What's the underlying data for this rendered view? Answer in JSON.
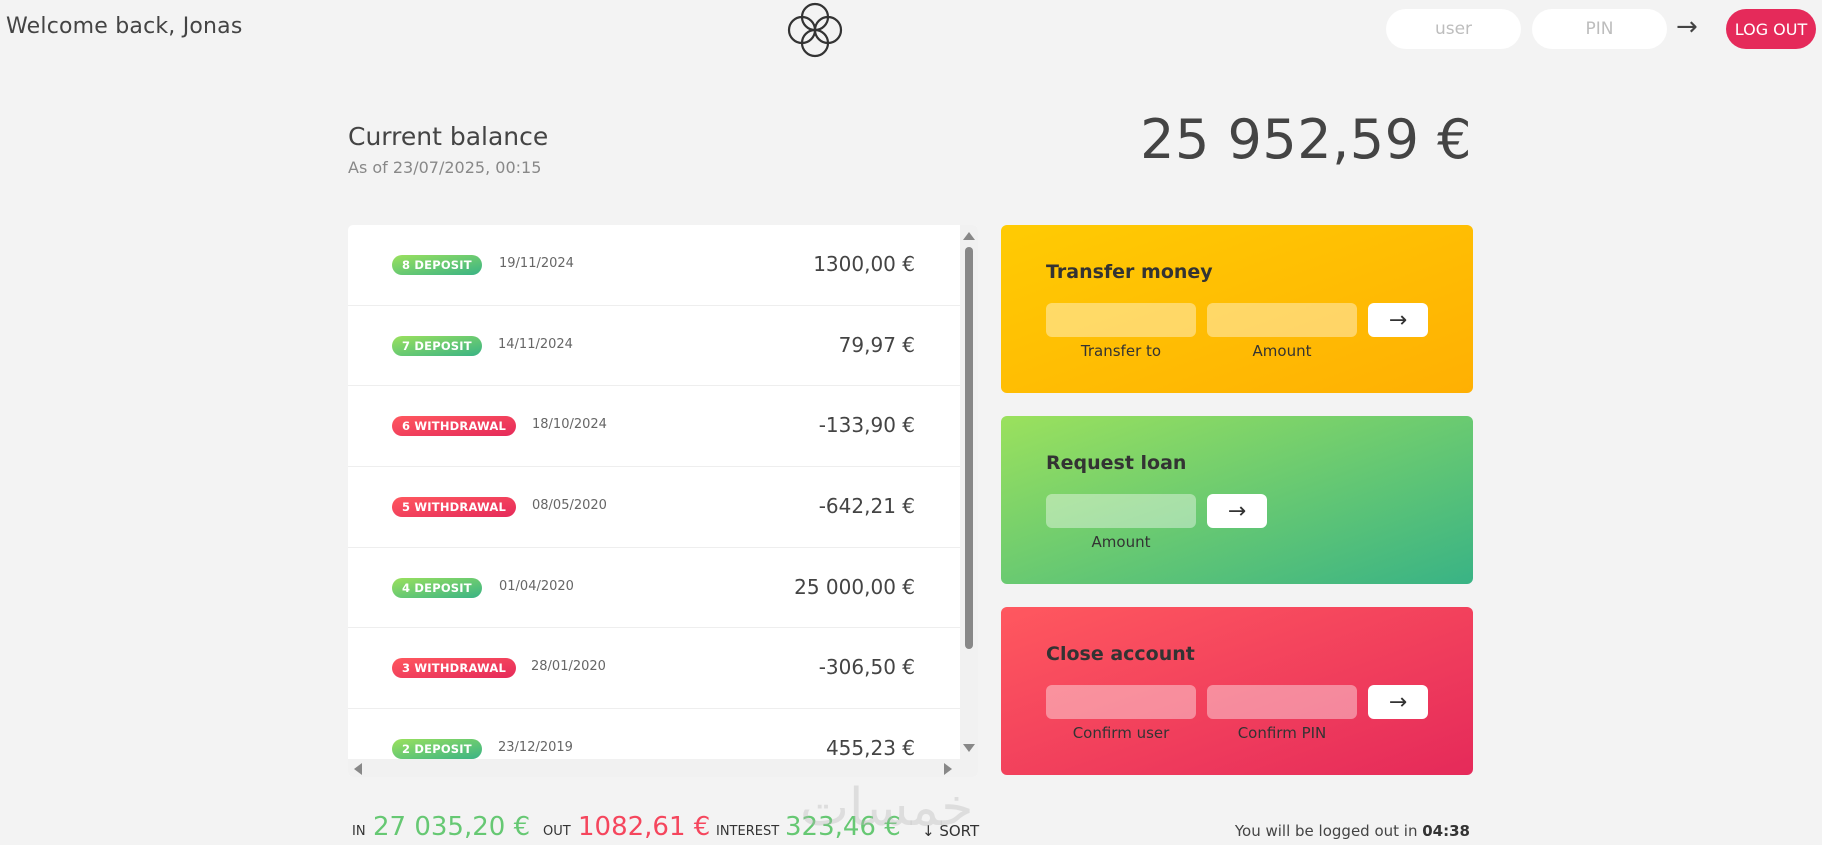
{
  "nav": {
    "welcome": "Welcome back, Jonas",
    "user_placeholder": "user",
    "pin_placeholder": "PIN",
    "login_arrow": "→",
    "logout_label": "LOG OUT"
  },
  "balance": {
    "title": "Current balance",
    "date_prefix": "As of 23/07/2025, 00:15",
    "value": "25 952,59 €"
  },
  "movements": [
    {
      "number_type": "8 DEPOSIT",
      "kind": "deposit",
      "date": "19/11/2024",
      "value": "1300,00 €"
    },
    {
      "number_type": "7 DEPOSIT",
      "kind": "deposit",
      "date": "14/11/2024",
      "value": "79,97 €"
    },
    {
      "number_type": "6 WITHDRAWAL",
      "kind": "withdrawal",
      "date": "18/10/2024",
      "value": "-133,90 €"
    },
    {
      "number_type": "5 WITHDRAWAL",
      "kind": "withdrawal",
      "date": "08/05/2020",
      "value": "-642,21 €"
    },
    {
      "number_type": "4 DEPOSIT",
      "kind": "deposit",
      "date": "01/04/2020",
      "value": "25 000,00 €"
    },
    {
      "number_type": "3 WITHDRAWAL",
      "kind": "withdrawal",
      "date": "28/01/2020",
      "value": "-306,50 €"
    },
    {
      "number_type": "2 DEPOSIT",
      "kind": "deposit",
      "date": "23/12/2019",
      "value": "455,23 €"
    }
  ],
  "operations": {
    "transfer": {
      "title": "Transfer money",
      "label_to": "Transfer to",
      "label_amount": "Amount",
      "button": "→"
    },
    "loan": {
      "title": "Request loan",
      "label_amount": "Amount",
      "button": "→"
    },
    "close": {
      "title": "Close account",
      "label_user": "Confirm user",
      "label_pin": "Confirm PIN",
      "button": "→"
    }
  },
  "summary": {
    "in_label": "In",
    "in_value": "27 035,20 €",
    "out_label": "Out",
    "out_value": "1082,61 €",
    "interest_label": "Interest",
    "interest_value": "323,46 €",
    "sort_label": "↓ SORT",
    "timer_prefix": "You will be logged out in",
    "timer_value": "04:38"
  },
  "watermark": "خمسات",
  "colors": {
    "deposit": "#66c873",
    "withdrawal": "#f5465d",
    "logout": "#e52a5a"
  }
}
